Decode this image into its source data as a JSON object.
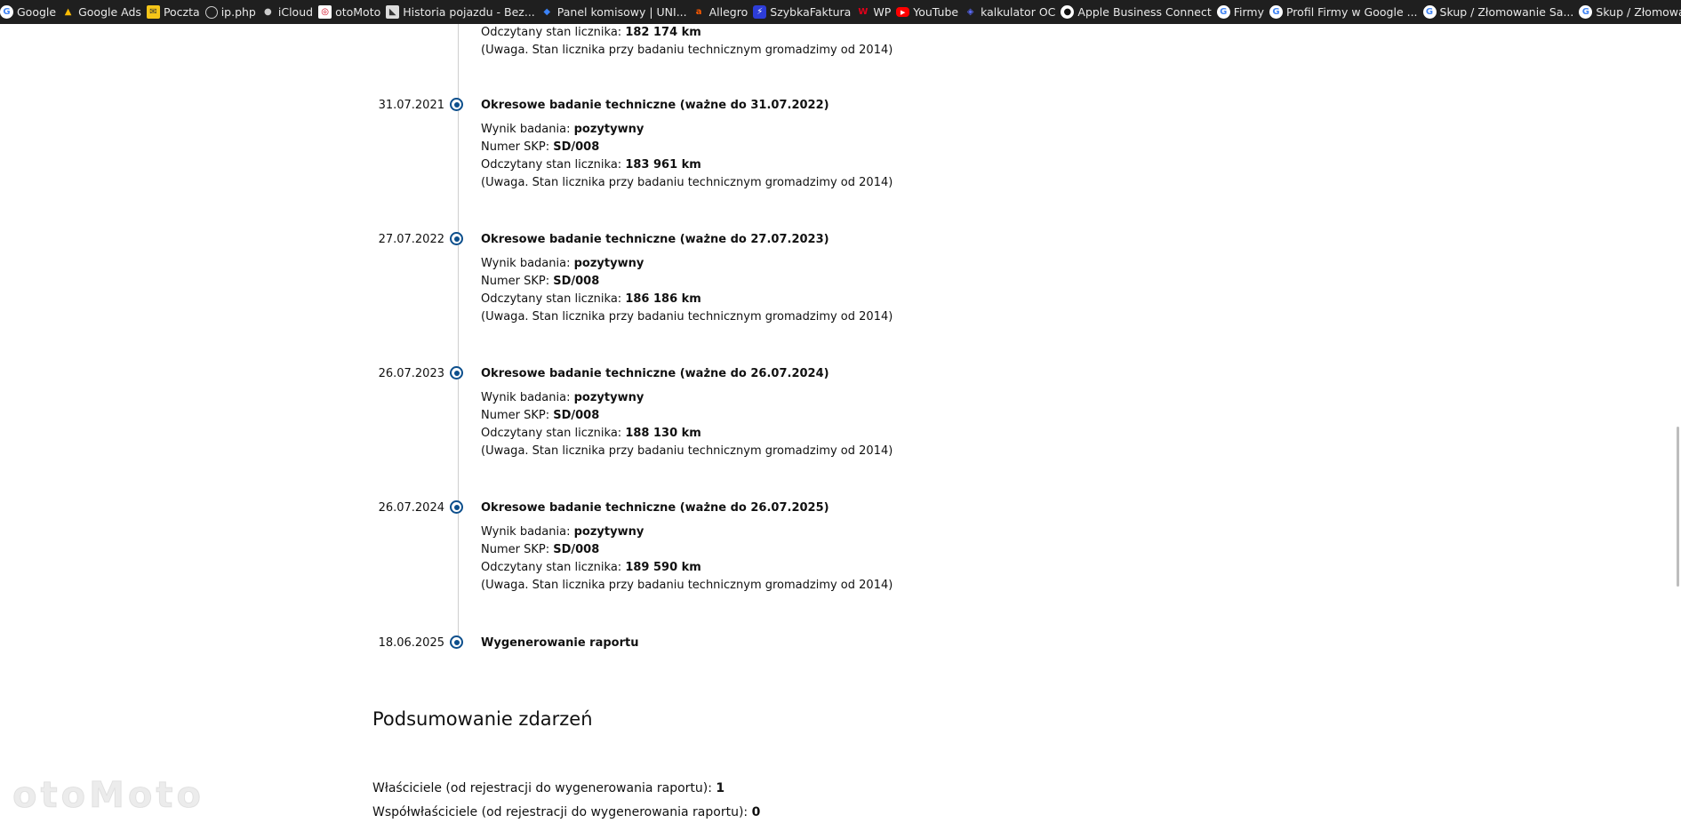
{
  "bookmarks": [
    {
      "label": "Google",
      "icon": "google-icon"
    },
    {
      "label": "Google Ads",
      "icon": "google-ads-icon"
    },
    {
      "label": "Poczta",
      "icon": "mail-icon"
    },
    {
      "label": "ip.php",
      "icon": "globe-icon"
    },
    {
      "label": "iCloud",
      "icon": "apple-icon"
    },
    {
      "label": "otoMoto",
      "icon": "otomoto-icon"
    },
    {
      "label": "Historia pojazdu - Bez...",
      "icon": "historia-icon"
    },
    {
      "label": "Panel komisowy | UNI...",
      "icon": "panel-icon"
    },
    {
      "label": "Allegro",
      "icon": "allegro-icon"
    },
    {
      "label": "SzybkaFaktura",
      "icon": "szybkafaktura-icon"
    },
    {
      "label": "WP",
      "icon": "wp-icon"
    },
    {
      "label": "YouTube",
      "icon": "youtube-icon"
    },
    {
      "label": "kalkulator OC",
      "icon": "kalkulator-icon"
    },
    {
      "label": "Apple Business Connect",
      "icon": "apple-business-icon"
    },
    {
      "label": "Firmy",
      "icon": "google-icon"
    },
    {
      "label": "Profil Firmy w Google ...",
      "icon": "google-icon"
    },
    {
      "label": "Skup / Złomowanie Sa...",
      "icon": "google-icon"
    },
    {
      "label": "Skup / Złomowanie Sa...",
      "icon": "google-icon"
    }
  ],
  "partial_entry": {
    "odometer_label": "Odczytany stan licznika: ",
    "odometer_value": "182 174 km",
    "note": "(Uwaga. Stan licznika przy badaniu technicznym gromadzimy od 2014)"
  },
  "labels": {
    "result": "Wynik badania: ",
    "skp": "Numer SKP: ",
    "odometer": "Odczytany stan licznika: ",
    "note": "(Uwaga. Stan licznika przy badaniu technicznym gromadzimy od 2014)"
  },
  "entries": [
    {
      "date": "31.07.2021",
      "title": "Okresowe badanie techniczne (ważne do 31.07.2022)",
      "result": "pozytywny",
      "skp": "SD/008",
      "odometer": "183 961 km"
    },
    {
      "date": "27.07.2022",
      "title": "Okresowe badanie techniczne (ważne do 27.07.2023)",
      "result": "pozytywny",
      "skp": "SD/008",
      "odometer": "186 186 km"
    },
    {
      "date": "26.07.2023",
      "title": "Okresowe badanie techniczne (ważne do 26.07.2024)",
      "result": "pozytywny",
      "skp": "SD/008",
      "odometer": "188 130 km"
    },
    {
      "date": "26.07.2024",
      "title": "Okresowe badanie techniczne (ważne do 26.07.2025)",
      "result": "pozytywny",
      "skp": "SD/008",
      "odometer": "189 590 km"
    }
  ],
  "final_entry": {
    "date": "18.06.2025",
    "title": "Wygenerowanie raportu"
  },
  "summary": {
    "title": "Podsumowanie zdarzeń",
    "owners_label": "Właściciele (od rejestracji do wygenerowania raportu): ",
    "owners_value": "1",
    "coowners_label": "Współwłaściciele (od rejestracji do wygenerowania raportu): ",
    "coowners_value": "0"
  },
  "watermark": "otoMoto",
  "colors": {
    "accent": "#0d4f8c",
    "bookmark_bar": "#1f1f1f"
  }
}
